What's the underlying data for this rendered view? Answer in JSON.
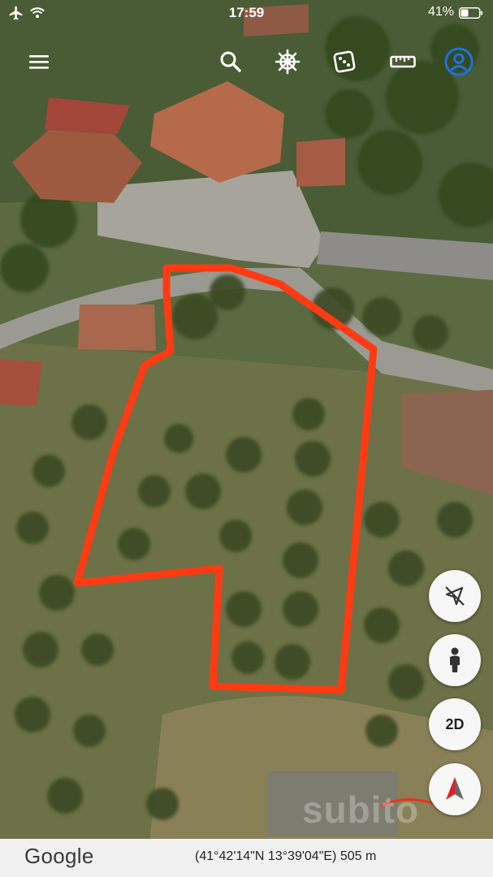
{
  "status_bar": {
    "time": "17:59",
    "battery_percent": "41%",
    "airplane_icon": "airplane-icon",
    "wifi_icon": "wifi-icon",
    "battery_icon": "battery-icon",
    "battery_level": 0.41
  },
  "toolbar": {
    "icons": [
      "menu-icon",
      "search-icon",
      "helm-icon",
      "dice-icon",
      "ruler-icon",
      "account-icon"
    ],
    "accent_color": "#1a73e8"
  },
  "map": {
    "type": "satellite",
    "highlight_color": "#ff3b14",
    "watermark": "subito"
  },
  "controls": {
    "location_button_icon": "location-off-icon",
    "pegman_button_icon": "pegman-icon",
    "view_mode_label": "2D",
    "compass_icon": "compass-icon"
  },
  "footer": {
    "brand": "Google",
    "coordinates": "(41°42'14\"N 13°39'04\"E)",
    "altitude": "505 m"
  }
}
